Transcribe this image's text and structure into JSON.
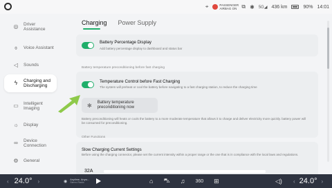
{
  "status_bar": {
    "airbag_text": "PASSENGER AIRBAG ON",
    "range": "436 km",
    "battery": "90%",
    "time": "14:01",
    "signal": "5G"
  },
  "sidebar": {
    "items": [
      {
        "label": "Driver Assistance",
        "icon": "steering-wheel-icon"
      },
      {
        "label": "Voice Assistant",
        "icon": "microphone-icon"
      },
      {
        "label": "Sounds",
        "icon": "speaker-icon"
      },
      {
        "label": "Charging and Discharging",
        "icon": "charging-icon",
        "active": true
      },
      {
        "label": "Intelligent Imaging",
        "icon": "projector-icon"
      },
      {
        "label": "Display",
        "icon": "brightness-icon"
      },
      {
        "label": "Device Connection",
        "icon": "link-icon"
      },
      {
        "label": "General",
        "icon": "settings-icon"
      }
    ]
  },
  "tabs": [
    {
      "label": "Charging",
      "active": true
    },
    {
      "label": "Power Supply",
      "active": false
    }
  ],
  "battery_percentage": {
    "title": "Battery Percentage Display",
    "desc": "Add battery percentage display to dashboard and status bar",
    "enabled": true
  },
  "preconditioning_section_label": "Battery temperature preconditioning before fast charging",
  "temperature_control": {
    "title": "Temperature Control before Fast Charging",
    "desc": "The system will preheat or cool the battery before navigating to a fast charging station, to reduce the charging time",
    "enabled": true,
    "button_label": "Battery temperature preconditioning now",
    "note": "Battery preconditioning will heats or cools the battery to a more moderate temperature that allows it to charge and deliver electricity more quickly. battery power will be consumed for preconditioning."
  },
  "other_functions_label": "Other Functions",
  "slow_charging": {
    "title": "Slow Charging Current Settings",
    "desc": "Before using the charging connector, please set the current intensity within a proper range or the one that is in compliance with the local laws and regulations.",
    "current_value": "32A"
  },
  "dock": {
    "left_temp": "24.0°",
    "right_temp": "24.0°",
    "media_title": "Anytime, Anyw...",
    "media_sub": "Stereo Radio",
    "dock_icons": [
      "home-icon",
      "car-icon",
      "music-icon",
      "360-view-icon",
      "apps-grid-icon"
    ],
    "volume_icon": "volume-icon"
  },
  "colors": {
    "accent": "#1fae6a",
    "arrow": "#8ec94a",
    "dock_bg": "#2e3340"
  }
}
